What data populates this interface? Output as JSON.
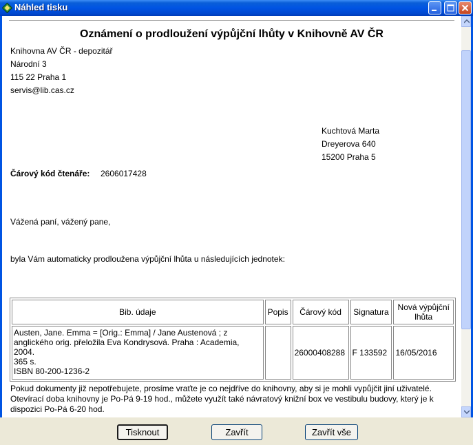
{
  "window": {
    "title": "Náhled tisku"
  },
  "document": {
    "heading": "Oznámení o prodloužení výpůjční lhůty v Knihovně AV ČR",
    "library": {
      "name": "Knihovna AV ČR - depozitář",
      "street": "Národní 3",
      "city": "115 22 Praha 1",
      "email": "servis@lib.cas.cz"
    },
    "recipient": {
      "name": "Kuchtová Marta",
      "street": "Dreyerova 640",
      "city": "15200 Praha 5"
    },
    "barcode_label": "Čárový kód čtenáře:",
    "barcode_value": "2606017428",
    "greeting": "Vážená paní, vážený pane,",
    "intro": "byla Vám automaticky prodloužena výpůjční lhůta u následujících jednotek:",
    "table": {
      "headers": [
        "Bib. údaje",
        "Popis",
        "Čárový kód",
        "Signatura",
        "Nová výpůjční lhůta"
      ],
      "rows": [
        {
          "bib_line1": "Austen, Jane. Emma = [Orig.: Emma] / Jane Austenová ; z",
          "bib_line2": "anglického orig. přeložila Eva Kondrysová. Praha : Academia, 2004.",
          "bib_line3": "365 s.",
          "bib_line4": "ISBN 80-200-1236-2",
          "popis": "",
          "barcode": "26000408288",
          "signatura": "F 133592",
          "due": "16/05/2016"
        }
      ]
    },
    "footer_line1": "Pokud dokumenty již nepotřebujete, prosíme vraťte je co nejdříve do knihovny, aby si je mohli vypůjčit jiní uživatelé.",
    "footer_line2": "Otevírací doba knihovny je Po-Pá 9-19 hod., můžete využít také návratový knižní box ve vestibulu budovy, který je k",
    "footer_line3": "dispozici Po-Pá 6-20 hod."
  },
  "buttons": {
    "print": "Tisknout",
    "close": "Zavřít",
    "close_all": "Zavřít vše"
  }
}
